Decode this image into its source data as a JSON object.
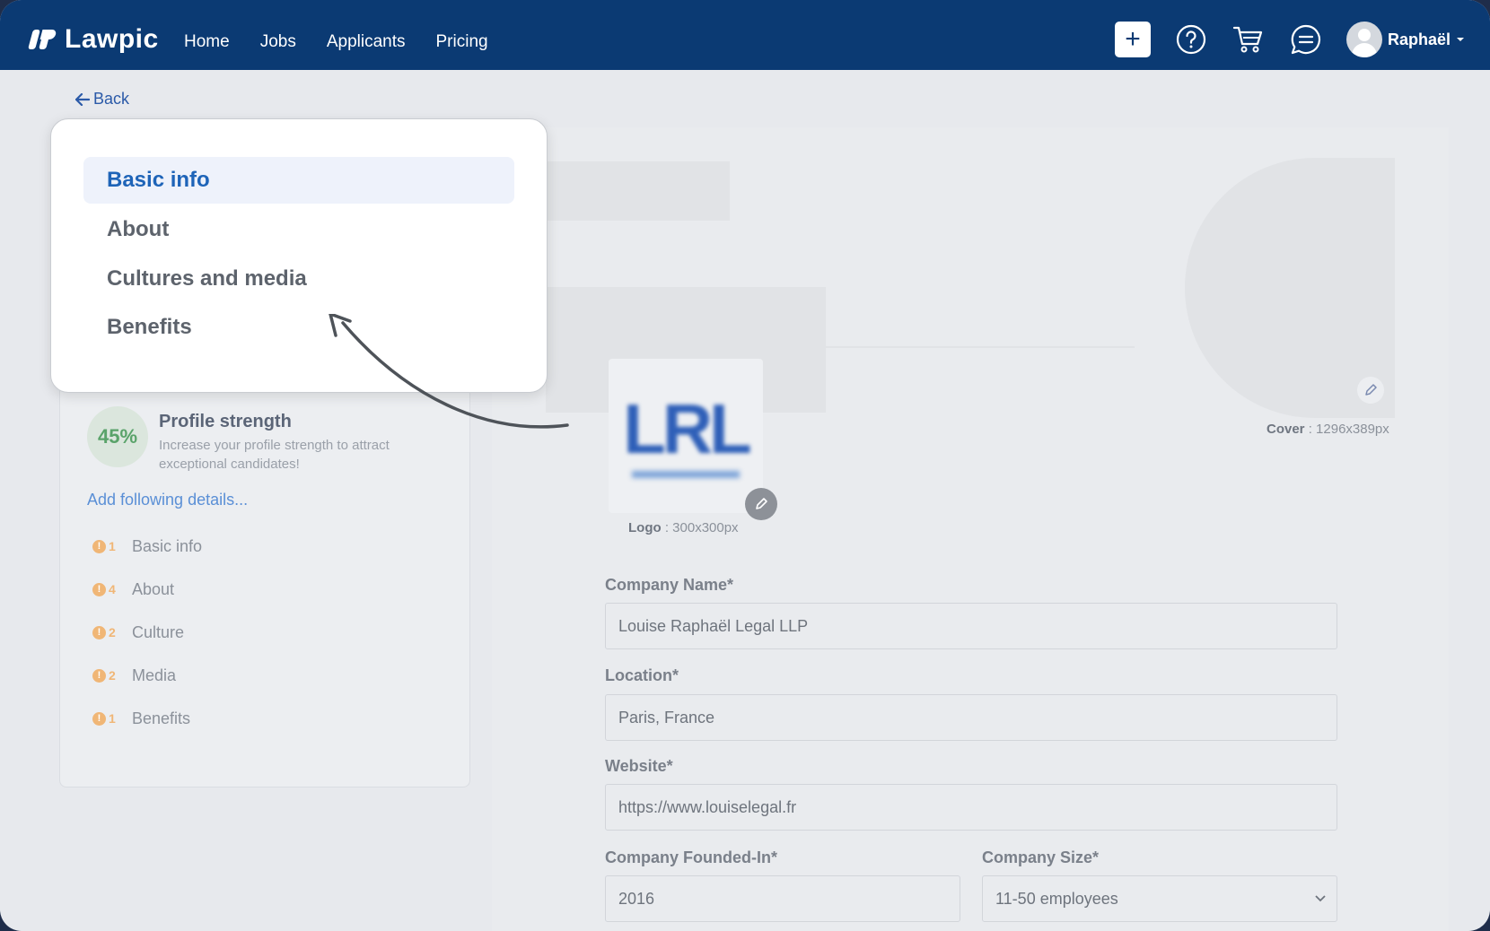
{
  "app": {
    "brand": "Lawpic",
    "user_name": "Raphaël"
  },
  "nav": {
    "items": [
      "Home",
      "Jobs",
      "Applicants",
      "Pricing"
    ]
  },
  "actions": {
    "add_symbol": "+"
  },
  "back_label": "Back",
  "popup_menu": {
    "items": [
      "Basic info",
      "About",
      "Cultures and media",
      "Benefits"
    ],
    "active_index": 0
  },
  "profile": {
    "strength_percent": "45%",
    "strength_title": "Profile strength",
    "strength_subtitle": "Increase your profile strength to attract exceptional candidates!",
    "add_details_label": "Add following details...",
    "checklist": [
      {
        "count": "1",
        "label": "Basic info"
      },
      {
        "count": "4",
        "label": "About"
      },
      {
        "count": "2",
        "label": "Culture"
      },
      {
        "count": "2",
        "label": "Media"
      },
      {
        "count": "1",
        "label": "Benefits"
      }
    ]
  },
  "media": {
    "cover_label": "Cover",
    "cover_size": ": 1296x389px",
    "logo_label": "Logo",
    "logo_size": ": 300x300px",
    "logo_text": "LRL"
  },
  "form": {
    "company_name_label": "Company Name*",
    "company_name_value": "Louise Raphaël Legal LLP",
    "location_label": "Location*",
    "location_value": "Paris, France",
    "website_label": "Website*",
    "website_value": "https://www.louiselegal.fr",
    "founded_label": "Company Founded-In*",
    "founded_value": "2016",
    "size_label": "Company Size*",
    "size_value": "11-50 employees"
  },
  "colors": {
    "navbar": "#0b3a73",
    "active_menu_text": "#1e64b8",
    "active_menu_bg": "#eef2fb",
    "strength_green": "#5aa36a",
    "badge_orange": "#f0b676"
  }
}
